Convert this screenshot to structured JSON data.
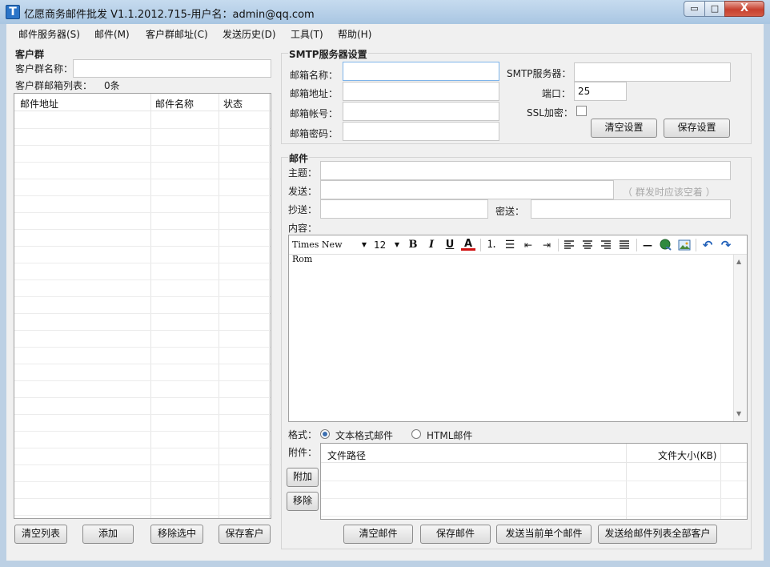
{
  "window": {
    "title": "亿愿商务邮件批发 V1.1.2012.715-用户名：admin@qq.com",
    "min": "▭",
    "max": "□",
    "close": "X"
  },
  "menu": [
    "邮件服务器(S)",
    "邮件(M)",
    "客户群邮址(C)",
    "发送历史(D)",
    "工具(T)",
    "帮助(H)"
  ],
  "customers": {
    "legend": "客户群",
    "name_label": "客户群名称：",
    "name_value": "",
    "list_label": "客户群邮箱列表：",
    "count": "0条",
    "columns": [
      "邮件地址",
      "邮件名称",
      "状态"
    ],
    "buttons": {
      "clear": "清空列表",
      "add": "添加",
      "remove": "移除选中",
      "save": "保存客户"
    }
  },
  "smtp": {
    "legend": "SMTP服务器设置",
    "email_name_label": "邮箱名称：",
    "email_addr_label": "邮箱地址：",
    "account_label": "邮箱帐号：",
    "password_label": "邮箱密码：",
    "server_label": "SMTP服务器：",
    "port_label": "端口：",
    "port_value": "25",
    "ssl_label": "SSL加密：",
    "buttons": {
      "clear": "清空设置",
      "save": "保存设置"
    }
  },
  "mail": {
    "legend": "邮件",
    "subject_label": "主题：",
    "to_label": "发送：",
    "to_hint": "（ 群发时应该空着 ）",
    "cc_label": "抄送：",
    "bcc_label": "密送：",
    "content_label": "内容：",
    "toolbar": {
      "font": "Times New Rom",
      "size": "12"
    },
    "format_label": "格式：",
    "format_text": "文本格式邮件",
    "format_html": "HTML邮件",
    "attach_label": "附件：",
    "attach_columns": [
      "文件路径",
      "文件大小(KB)"
    ],
    "attach_buttons": {
      "add": "附加",
      "remove": "移除"
    },
    "buttons": {
      "clear": "清空邮件",
      "save": "保存邮件",
      "send_one": "发送当前单个邮件",
      "send_all": "发送给邮件列表全部客户"
    }
  }
}
